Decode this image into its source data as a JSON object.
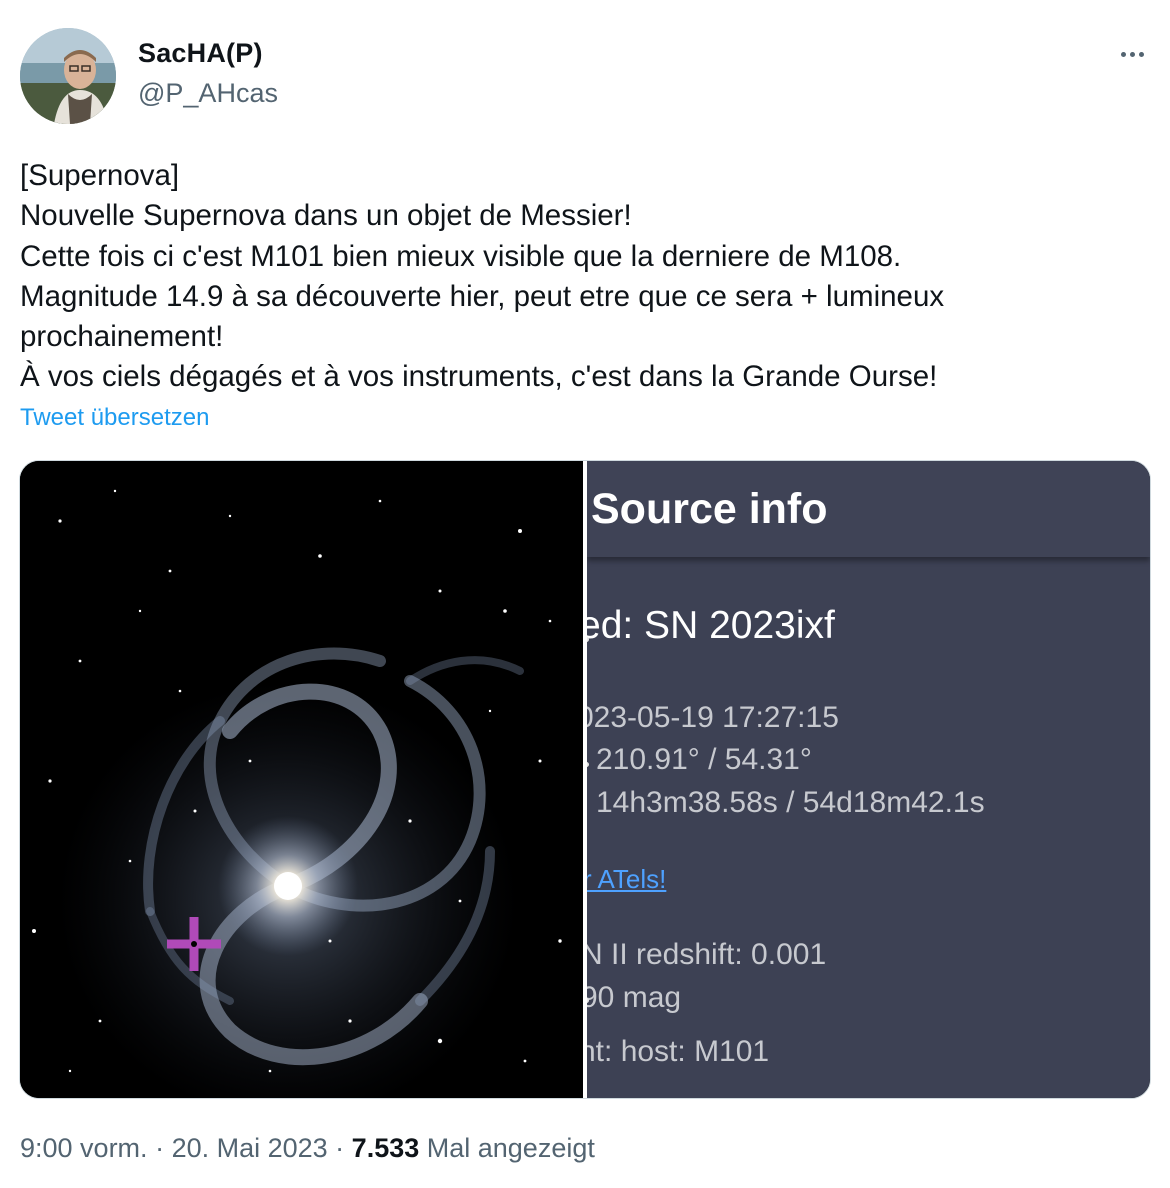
{
  "author": {
    "display_name": "SacHA(P)",
    "handle": "@P_AHcas"
  },
  "tweet": {
    "lines": [
      "[Supernova]",
      "Nouvelle Supernova dans un objet de Messier!",
      "Cette fois ci c'est M101 bien mieux visible que la derniere de M108.",
      "Magnitude 14.9 à sa découverte hier, peut etre que ce sera + lumineux",
      "prochainement!",
      "À vos ciels dégagés et à vos instruments, c'est dans la Grande Ourse!"
    ],
    "translate_label": "Tweet übersetzen"
  },
  "media": {
    "source_panel": {
      "title": "Source info",
      "name_line": "ed: SN 2023ixf",
      "date_line": "023-05-19 17:27:15",
      "deg_line": "210.91° / 54.31°",
      "hms_line": "14h3m38.58s / 54d18m42.1s",
      "link_text": "r ATels!",
      "type_line": "N II    redshift: 0.001",
      "mag_line": "90 mag",
      "host_line": "nt: host: M101"
    },
    "marker_color": "#b04ab8"
  },
  "footer": {
    "time": "9:00 vorm.",
    "sep1": " · ",
    "date": "20. Mai 2023",
    "sep2": " · ",
    "views": "7.533",
    "views_label": " Mal angezeigt"
  },
  "colors": {
    "link": "#1d9bf0",
    "secondary_text": "#536471",
    "panel_bg": "#3d4154"
  },
  "icons": {
    "more": "more-horizontal-icon",
    "marker": "crosshair-marker-icon"
  }
}
